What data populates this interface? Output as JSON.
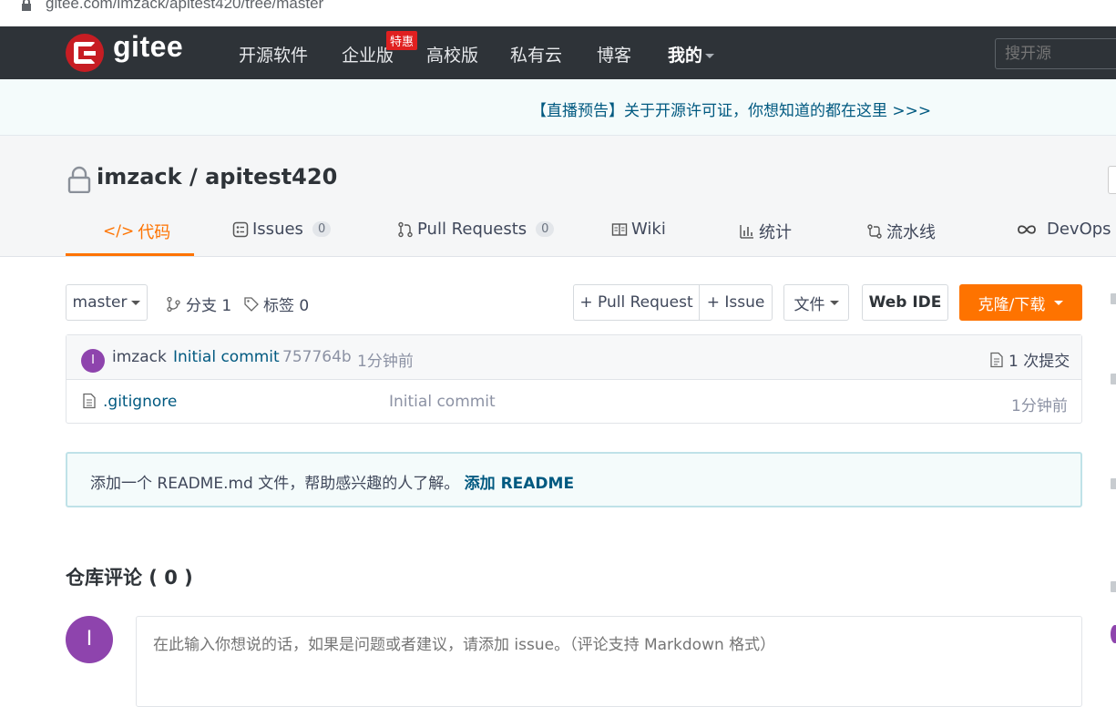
{
  "browser": {
    "url": "gitee.com/imzack/apitest420/tree/master"
  },
  "topnav": {
    "brand": "gitee",
    "items": [
      "开源软件",
      "企业版",
      "高校版",
      "私有云",
      "博客"
    ],
    "hot_badge": "特惠",
    "mine": "我的",
    "search_placeholder": "搜开源"
  },
  "notice": {
    "text": "【直播预告】关于开源许可证，你想知道的都在这里 >>>"
  },
  "repo": {
    "title": "imzack / apitest420",
    "tabs": [
      {
        "label": "代码",
        "icon": "code-icon"
      },
      {
        "label": "Issues",
        "count": "0",
        "icon": "issues-icon"
      },
      {
        "label": "Pull Requests",
        "count": "0",
        "icon": "pull-request-icon"
      },
      {
        "label": "Wiki",
        "icon": "wiki-icon"
      },
      {
        "label": "统计",
        "icon": "stats-icon"
      },
      {
        "label": "流水线",
        "icon": "pipeline-icon"
      },
      {
        "label": "DevOps",
        "icon": "devops-icon"
      }
    ]
  },
  "toolbar": {
    "branch": "master",
    "branches": "分支 1",
    "tags": "标签 0",
    "pull_request": "+ Pull Request",
    "issue": "+ Issue",
    "file": "文件",
    "web_ide": "Web IDE",
    "clone": "克隆/下载"
  },
  "commit": {
    "avatar_letter": "I",
    "author": "imzack",
    "message": "Initial commit",
    "hash": "757764b",
    "time": "1分钟前",
    "count": "1 次提交"
  },
  "files": [
    {
      "name": ".gitignore",
      "message": "Initial commit",
      "time": "1分钟前"
    }
  ],
  "readme": {
    "text": "添加一个 README.md 文件，帮助感兴趣的人了解。",
    "link": "添加 README"
  },
  "comments": {
    "title": "仓库评论 ( 0 )",
    "avatar_letter": "I",
    "placeholder": "在此输入你想说的话，如果是问题或者建议，请添加 issue。（评论支持 Markdown 格式）"
  },
  "colors": {
    "nav_bg": "#2e3338",
    "accent": "#fe7300",
    "brand_red": "#c71d23",
    "link": "#005980",
    "avatar": "#8e44ad"
  }
}
